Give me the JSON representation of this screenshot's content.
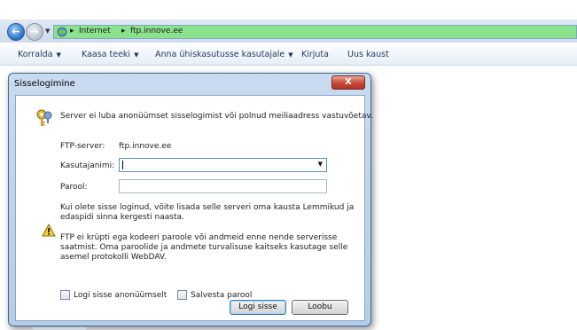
{
  "explorer": {
    "breadcrumb": [
      "Internet",
      "ftp.innove.ee"
    ],
    "separator": "▸",
    "commands": [
      {
        "label": "Korralda",
        "has_dropdown": true
      },
      {
        "label": "Kaasa teeki",
        "has_dropdown": true
      },
      {
        "label": "Anna ühiskasutusse kasutajale",
        "has_dropdown": true
      },
      {
        "label": "Kirjuta",
        "has_dropdown": false
      },
      {
        "label": "Uus kaust",
        "has_dropdown": false
      }
    ],
    "address_color": "#8be28d"
  },
  "dialog": {
    "title": "Sisselogimine",
    "close_glyph": "X",
    "message": "Server ei luba anonüümset sisselogimist või polnud meiliaadress vastuvõetav.",
    "ftp_label": "FTP-server:",
    "ftp_value": "ftp.innove.ee",
    "username_label": "Kasutajanimi:",
    "username_value": "",
    "password_label": "Parool:",
    "password_value": "",
    "info_text": "Kui olete sisse loginud, võite lisada selle serveri oma kausta Lemmikud ja edaspidi sinna kergesti naasta.",
    "warning_text": "FTP ei krüpti ega kodeeri paroole või andmeid enne nende serverisse saatmist. Oma paroolide ja andmete turvalisuse kaitseks kasutage selle asemel protokolli WebDAV.",
    "anonymous_label": "Logi sisse anonüümselt",
    "anonymous_checked": false,
    "save_password_label": "Salvesta parool",
    "save_password_checked": false,
    "login_button": "Logi sisse",
    "cancel_button": "Loobu"
  }
}
